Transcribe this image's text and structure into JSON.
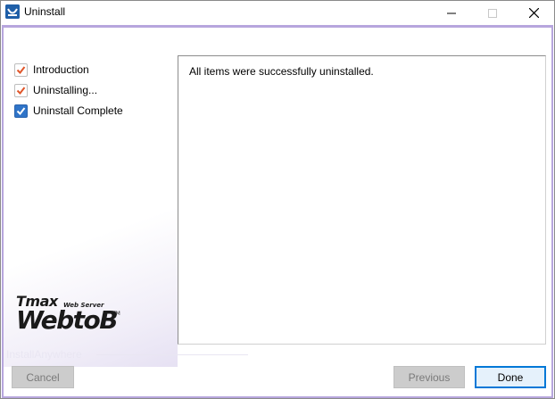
{
  "window": {
    "title": "Uninstall",
    "icon": "installer-app-icon",
    "controls": [
      "minimize-icon",
      "maximize-icon",
      "close-icon"
    ]
  },
  "steps": [
    {
      "label": "Introduction",
      "state": "done"
    },
    {
      "label": "Uninstalling...",
      "state": "done"
    },
    {
      "label": "Uninstall Complete",
      "state": "current"
    }
  ],
  "logo": {
    "brand": "Tmax",
    "tagline": "Web Server",
    "product": "WebtoB",
    "trademark": "TM"
  },
  "main": {
    "message": "All items were successfully uninstalled."
  },
  "footer": {
    "label": "InstallAnywhere",
    "cancel_label": "Cancel",
    "previous_label": "Previous",
    "done_label": "Done"
  },
  "colors": {
    "frame_border": "#b7a6dd",
    "check_accent": "#e0562a",
    "check_current": "#2f74c8",
    "default_button_border": "#0078d7",
    "disabled_button": "#cccccc"
  }
}
